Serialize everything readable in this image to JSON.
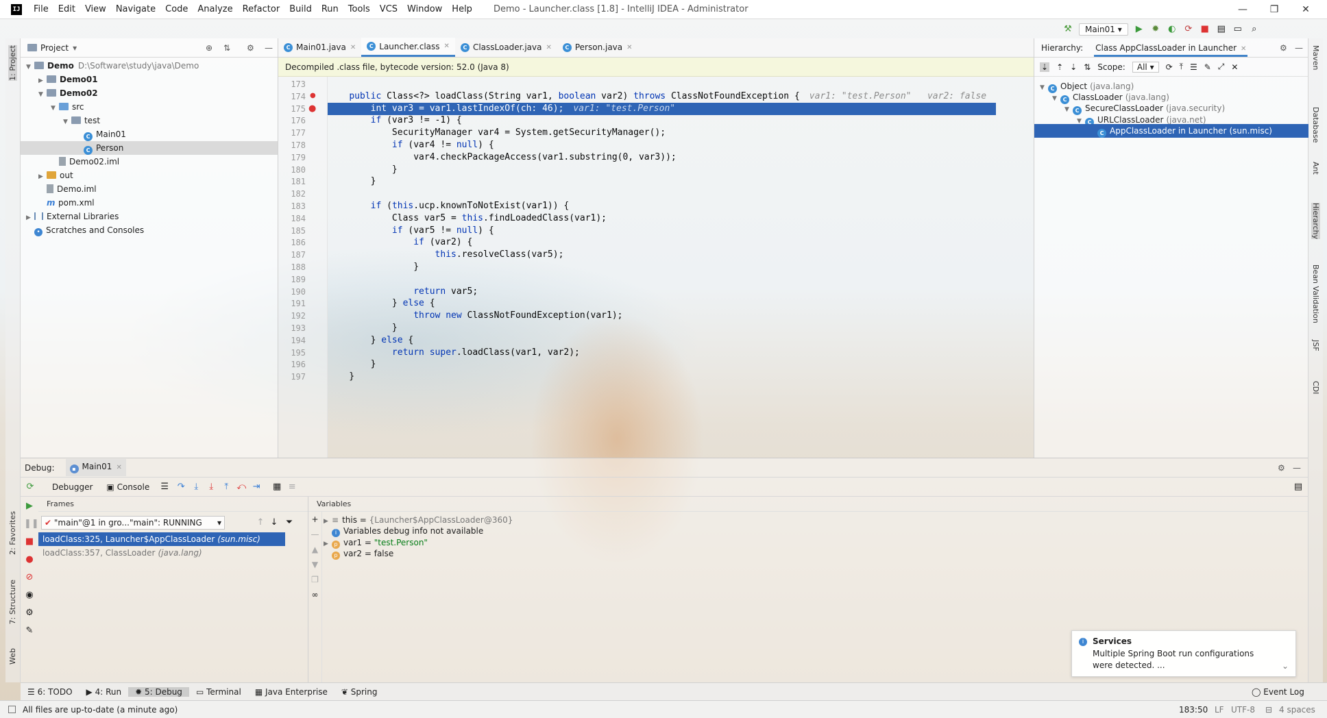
{
  "window": {
    "title": "Demo - Launcher.class [1.8] - IntelliJ IDEA - Administrator",
    "menu": [
      "File",
      "Edit",
      "View",
      "Navigate",
      "Code",
      "Analyze",
      "Refactor",
      "Build",
      "Run",
      "Tools",
      "VCS",
      "Window",
      "Help"
    ],
    "controls": {
      "minimize": "—",
      "restore": "❐",
      "close": "✕"
    }
  },
  "toolbar": {
    "run_config": "Main01"
  },
  "left_stripe": {
    "project": "1: Project",
    "favorites": "2: Favorites",
    "structure": "7: Structure",
    "web": "Web"
  },
  "right_stripe": {
    "maven": "Maven",
    "database": "Database",
    "ant": "Ant",
    "hierarchy": "Hierarchy",
    "bean_validation": "Bean Validation",
    "jsf": "JSF",
    "cdi": "CDI"
  },
  "project": {
    "header": "Project",
    "tree": [
      {
        "name": "Demo",
        "path": "D:\\Software\\study\\java\\Demo",
        "depth": 0,
        "kind": "module",
        "arrow": "▼"
      },
      {
        "name": "Demo01",
        "depth": 1,
        "kind": "module",
        "arrow": "▶"
      },
      {
        "name": "Demo02",
        "depth": 1,
        "kind": "module",
        "arrow": "▼"
      },
      {
        "name": "src",
        "depth": 2,
        "kind": "src",
        "arrow": "▼"
      },
      {
        "name": "test",
        "depth": 3,
        "kind": "package",
        "arrow": "▼"
      },
      {
        "name": "Main01",
        "depth": 4,
        "kind": "class",
        "arrow": ""
      },
      {
        "name": "Person",
        "depth": 4,
        "kind": "class",
        "arrow": "",
        "selected": true
      },
      {
        "name": "Demo02.iml",
        "depth": 2,
        "kind": "file",
        "arrow": ""
      },
      {
        "name": "out",
        "depth": 1,
        "kind": "out",
        "arrow": "▶"
      },
      {
        "name": "Demo.iml",
        "depth": 1,
        "kind": "file",
        "arrow": ""
      },
      {
        "name": "pom.xml",
        "depth": 1,
        "kind": "maven",
        "arrow": ""
      },
      {
        "name": "External Libraries",
        "depth": 0,
        "kind": "lib",
        "arrow": "▶"
      },
      {
        "name": "Scratches and Consoles",
        "depth": 0,
        "kind": "scratch",
        "arrow": ""
      }
    ]
  },
  "editor": {
    "tabs": [
      {
        "label": "Main01.java",
        "active": false
      },
      {
        "label": "Launcher.class",
        "active": true
      },
      {
        "label": "ClassLoader.java",
        "active": false
      },
      {
        "label": "Person.java",
        "active": false
      }
    ],
    "banner": "Decompiled .class file, bytecode version: 52.0 (Java 8)",
    "line_numbers": [
      "173",
      "174",
      "175",
      "176",
      "177",
      "178",
      "179",
      "180",
      "181",
      "182",
      "183",
      "184",
      "185",
      "186",
      "187",
      "188",
      "189",
      "190",
      "191",
      "192",
      "193",
      "194",
      "195",
      "196",
      "197"
    ],
    "lines": [
      "",
      "    public Class<?> loadClass(String var1, boolean var2) throws ClassNotFoundException {",
      "        int var3 = var1.lastIndexOf(ch: 46);",
      "        if (var3 != -1) {",
      "            SecurityManager var4 = System.getSecurityManager();",
      "            if (var4 != null) {",
      "                var4.checkPackageAccess(var1.substring(0, var3));",
      "            }",
      "        }",
      "",
      "        if (this.ucp.knownToNotExist(var1)) {",
      "            Class var5 = this.findLoadedClass(var1);",
      "            if (var5 != null) {",
      "                if (var2) {",
      "                    this.resolveClass(var5);",
      "                }",
      "",
      "                return var5;",
      "            } else {",
      "                throw new ClassNotFoundException(var1);",
      "            }",
      "        } else {",
      "            return super.loadClass(var1, var2);",
      "        }",
      "    }"
    ],
    "inline_hints": {
      "line174": "var1: \"test.Person\"   var2: false",
      "line175": "var1: \"test.Person\""
    },
    "exec_line_index": 2
  },
  "hierarchy": {
    "title": "Hierarchy:",
    "tab": "Class AppClassLoader in Launcher",
    "scope_label": "Scope:",
    "scope_value": "All",
    "tree": [
      {
        "name": "Object",
        "pkg": "(java.lang)",
        "depth": 0
      },
      {
        "name": "ClassLoader",
        "pkg": "(java.lang)",
        "depth": 1
      },
      {
        "name": "SecureClassLoader",
        "pkg": "(java.security)",
        "depth": 2
      },
      {
        "name": "URLClassLoader",
        "pkg": "(java.net)",
        "depth": 3
      },
      {
        "name": "AppClassLoader in Launcher",
        "pkg": "(sun.misc)",
        "depth": 4,
        "selected": true
      }
    ]
  },
  "debug": {
    "label": "Debug:",
    "session_tab": "Main01",
    "debugger_tab": "Debugger",
    "console_tab": "Console",
    "frames_header": "Frames",
    "variables_header": "Variables",
    "thread": "\"main\"@1 in gro...\"main\": RUNNING",
    "frames": [
      {
        "method": "loadClass:325, Launcher$AppClassLoader",
        "pkg": "(sun.misc)",
        "selected": true
      },
      {
        "method": "loadClass:357, ClassLoader",
        "pkg": "(java.lang)",
        "selected": false
      }
    ],
    "variables": [
      {
        "name": "this",
        "value": "{Launcher$AppClassLoader@360}",
        "kind": "object"
      },
      {
        "name": "",
        "value": "Variables debug info not available",
        "kind": "info"
      },
      {
        "name": "var1",
        "value": "\"test.Person\"",
        "kind": "param"
      },
      {
        "name": "var2",
        "value": "false",
        "kind": "param"
      }
    ]
  },
  "services": {
    "title": "Services",
    "message_line1": "Multiple Spring Boot run configurations",
    "message_line2": "were detected. ..."
  },
  "bottom_tabs": [
    {
      "label": "6: TODO",
      "active": false
    },
    {
      "label": "4: Run",
      "active": false
    },
    {
      "label": "5: Debug",
      "active": true
    },
    {
      "label": "Terminal",
      "active": false
    },
    {
      "label": "Java Enterprise",
      "active": false
    },
    {
      "label": "Spring",
      "active": false
    }
  ],
  "event_log": "Event Log",
  "status": {
    "message": "All files are up-to-date (a minute ago)",
    "position": "183:50",
    "line_sep": "LF",
    "encoding": "UTF-8",
    "indent": "4 spaces"
  },
  "colors": {
    "selection": "#2e64b5",
    "accent": "#4083c9",
    "keyword": "#0033b3",
    "banner": "#f5f6da"
  }
}
